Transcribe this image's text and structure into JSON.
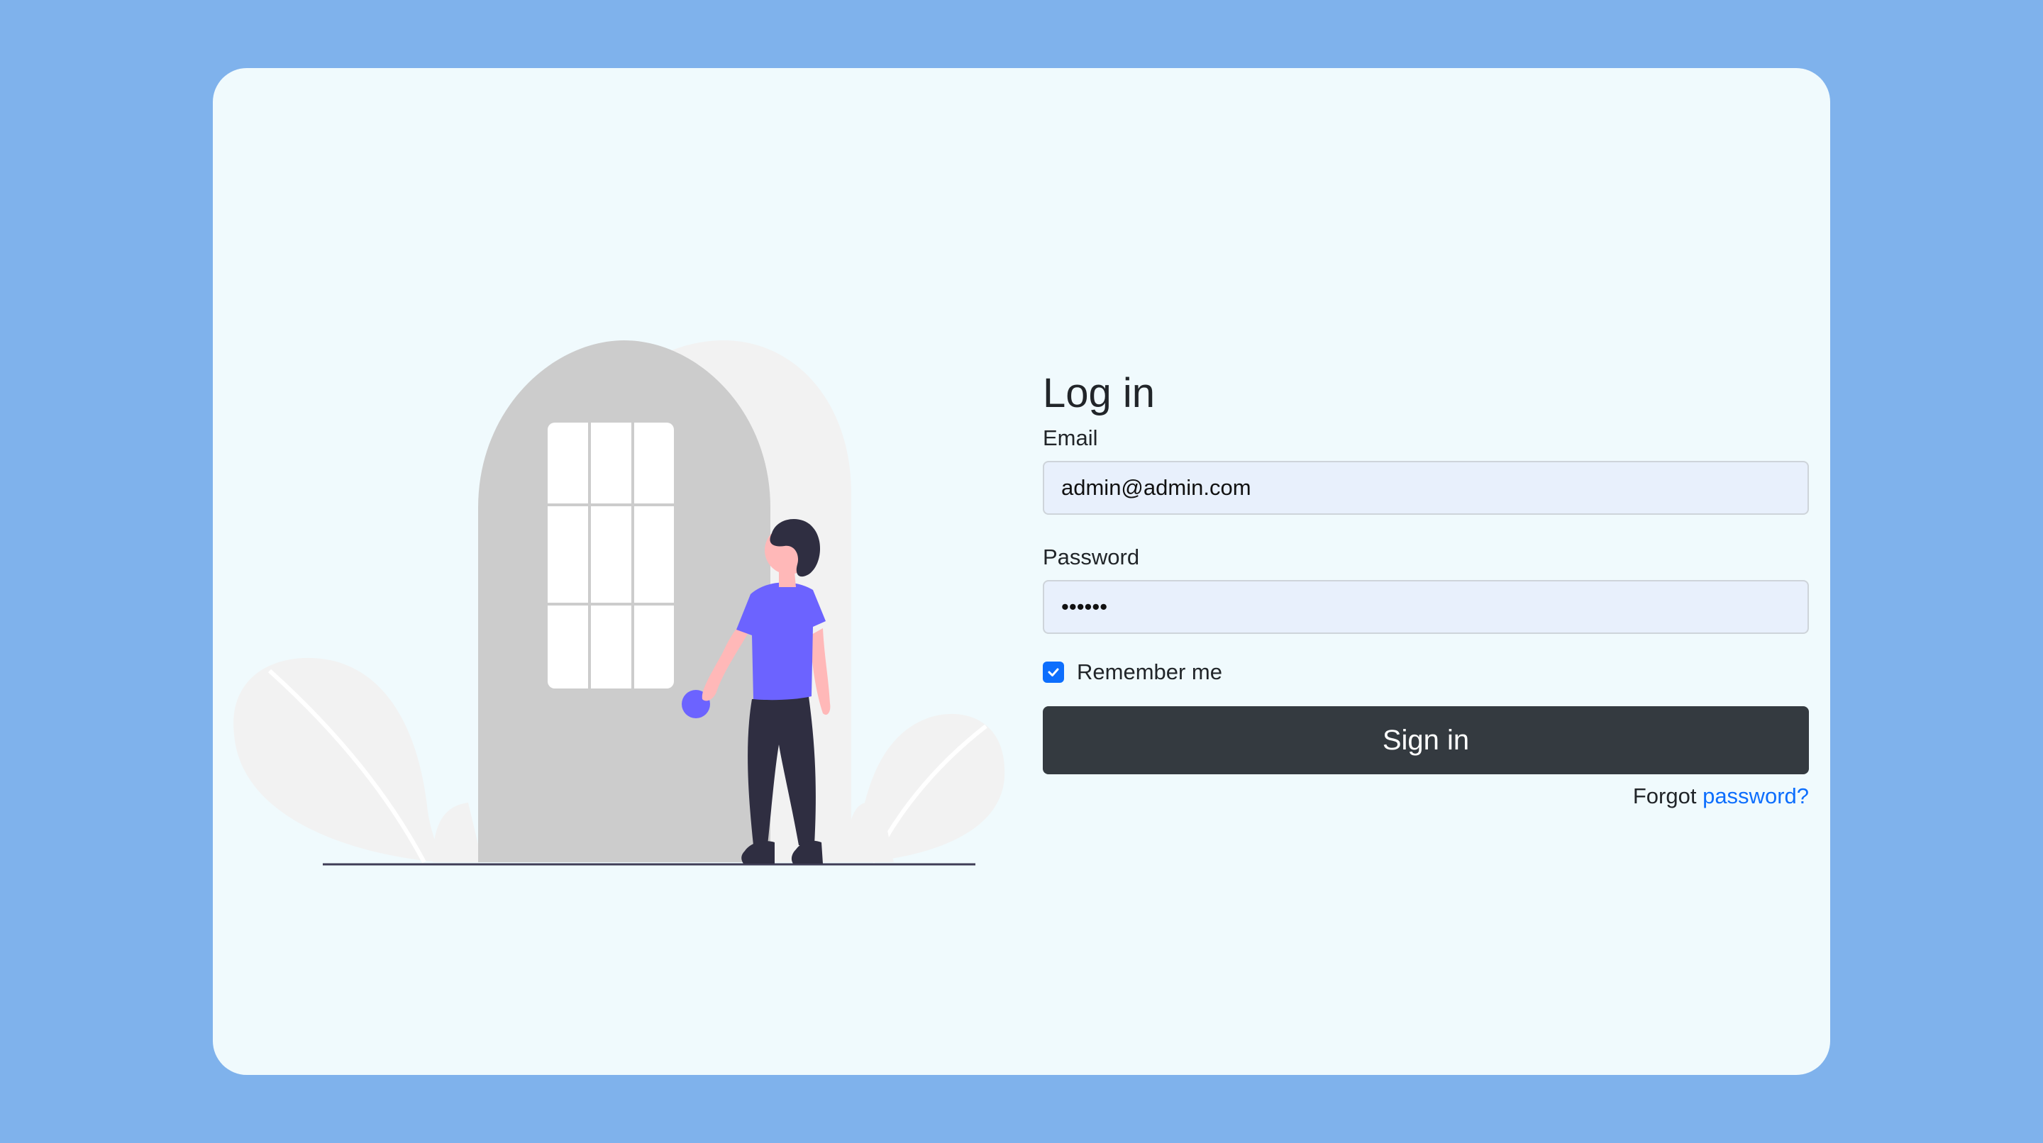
{
  "login": {
    "title": "Log in",
    "email_label": "Email",
    "email_value": "admin@admin.com",
    "password_label": "Password",
    "password_value": "••••••",
    "remember_label": "Remember me",
    "remember_checked": true,
    "signin_label": "Sign in",
    "forgot_prefix": "Forgot",
    "forgot_link": "password?"
  },
  "colors": {
    "page_background": "#7fb2ec",
    "card_background": "#f0fafd",
    "button_background": "#343a40",
    "link": "#0d6efd",
    "illustration_shirt": "#6c63ff",
    "illustration_pants": "#2f2e41",
    "illustration_door": "#cccccc"
  },
  "illustration": {
    "icon": "person-at-door-illustration"
  }
}
